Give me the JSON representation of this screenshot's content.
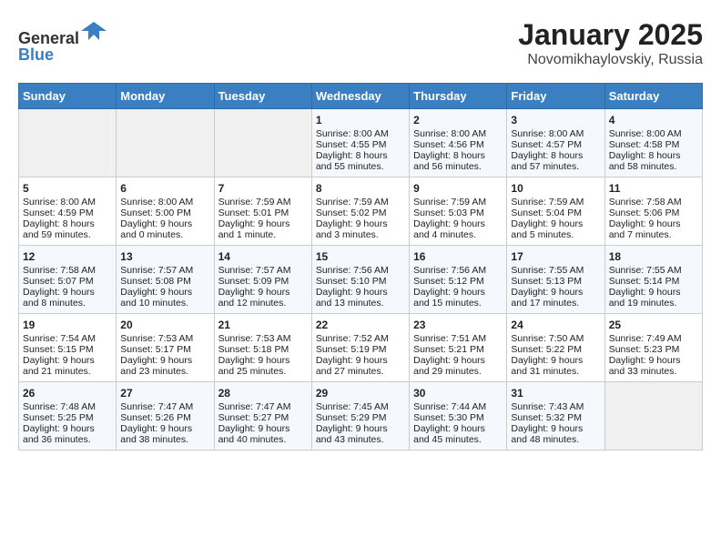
{
  "header": {
    "logo_line1": "General",
    "logo_line2": "Blue",
    "month": "January 2025",
    "location": "Novomikhaylovskiy, Russia"
  },
  "weekdays": [
    "Sunday",
    "Monday",
    "Tuesday",
    "Wednesday",
    "Thursday",
    "Friday",
    "Saturday"
  ],
  "weeks": [
    [
      {
        "day": "",
        "info": ""
      },
      {
        "day": "",
        "info": ""
      },
      {
        "day": "",
        "info": ""
      },
      {
        "day": "1",
        "info": "Sunrise: 8:00 AM\nSunset: 4:55 PM\nDaylight: 8 hours\nand 55 minutes."
      },
      {
        "day": "2",
        "info": "Sunrise: 8:00 AM\nSunset: 4:56 PM\nDaylight: 8 hours\nand 56 minutes."
      },
      {
        "day": "3",
        "info": "Sunrise: 8:00 AM\nSunset: 4:57 PM\nDaylight: 8 hours\nand 57 minutes."
      },
      {
        "day": "4",
        "info": "Sunrise: 8:00 AM\nSunset: 4:58 PM\nDaylight: 8 hours\nand 58 minutes."
      }
    ],
    [
      {
        "day": "5",
        "info": "Sunrise: 8:00 AM\nSunset: 4:59 PM\nDaylight: 8 hours\nand 59 minutes."
      },
      {
        "day": "6",
        "info": "Sunrise: 8:00 AM\nSunset: 5:00 PM\nDaylight: 9 hours\nand 0 minutes."
      },
      {
        "day": "7",
        "info": "Sunrise: 7:59 AM\nSunset: 5:01 PM\nDaylight: 9 hours\nand 1 minute."
      },
      {
        "day": "8",
        "info": "Sunrise: 7:59 AM\nSunset: 5:02 PM\nDaylight: 9 hours\nand 3 minutes."
      },
      {
        "day": "9",
        "info": "Sunrise: 7:59 AM\nSunset: 5:03 PM\nDaylight: 9 hours\nand 4 minutes."
      },
      {
        "day": "10",
        "info": "Sunrise: 7:59 AM\nSunset: 5:04 PM\nDaylight: 9 hours\nand 5 minutes."
      },
      {
        "day": "11",
        "info": "Sunrise: 7:58 AM\nSunset: 5:06 PM\nDaylight: 9 hours\nand 7 minutes."
      }
    ],
    [
      {
        "day": "12",
        "info": "Sunrise: 7:58 AM\nSunset: 5:07 PM\nDaylight: 9 hours\nand 8 minutes."
      },
      {
        "day": "13",
        "info": "Sunrise: 7:57 AM\nSunset: 5:08 PM\nDaylight: 9 hours\nand 10 minutes."
      },
      {
        "day": "14",
        "info": "Sunrise: 7:57 AM\nSunset: 5:09 PM\nDaylight: 9 hours\nand 12 minutes."
      },
      {
        "day": "15",
        "info": "Sunrise: 7:56 AM\nSunset: 5:10 PM\nDaylight: 9 hours\nand 13 minutes."
      },
      {
        "day": "16",
        "info": "Sunrise: 7:56 AM\nSunset: 5:12 PM\nDaylight: 9 hours\nand 15 minutes."
      },
      {
        "day": "17",
        "info": "Sunrise: 7:55 AM\nSunset: 5:13 PM\nDaylight: 9 hours\nand 17 minutes."
      },
      {
        "day": "18",
        "info": "Sunrise: 7:55 AM\nSunset: 5:14 PM\nDaylight: 9 hours\nand 19 minutes."
      }
    ],
    [
      {
        "day": "19",
        "info": "Sunrise: 7:54 AM\nSunset: 5:15 PM\nDaylight: 9 hours\nand 21 minutes."
      },
      {
        "day": "20",
        "info": "Sunrise: 7:53 AM\nSunset: 5:17 PM\nDaylight: 9 hours\nand 23 minutes."
      },
      {
        "day": "21",
        "info": "Sunrise: 7:53 AM\nSunset: 5:18 PM\nDaylight: 9 hours\nand 25 minutes."
      },
      {
        "day": "22",
        "info": "Sunrise: 7:52 AM\nSunset: 5:19 PM\nDaylight: 9 hours\nand 27 minutes."
      },
      {
        "day": "23",
        "info": "Sunrise: 7:51 AM\nSunset: 5:21 PM\nDaylight: 9 hours\nand 29 minutes."
      },
      {
        "day": "24",
        "info": "Sunrise: 7:50 AM\nSunset: 5:22 PM\nDaylight: 9 hours\nand 31 minutes."
      },
      {
        "day": "25",
        "info": "Sunrise: 7:49 AM\nSunset: 5:23 PM\nDaylight: 9 hours\nand 33 minutes."
      }
    ],
    [
      {
        "day": "26",
        "info": "Sunrise: 7:48 AM\nSunset: 5:25 PM\nDaylight: 9 hours\nand 36 minutes."
      },
      {
        "day": "27",
        "info": "Sunrise: 7:47 AM\nSunset: 5:26 PM\nDaylight: 9 hours\nand 38 minutes."
      },
      {
        "day": "28",
        "info": "Sunrise: 7:47 AM\nSunset: 5:27 PM\nDaylight: 9 hours\nand 40 minutes."
      },
      {
        "day": "29",
        "info": "Sunrise: 7:45 AM\nSunset: 5:29 PM\nDaylight: 9 hours\nand 43 minutes."
      },
      {
        "day": "30",
        "info": "Sunrise: 7:44 AM\nSunset: 5:30 PM\nDaylight: 9 hours\nand 45 minutes."
      },
      {
        "day": "31",
        "info": "Sunrise: 7:43 AM\nSunset: 5:32 PM\nDaylight: 9 hours\nand 48 minutes."
      },
      {
        "day": "",
        "info": ""
      }
    ]
  ]
}
